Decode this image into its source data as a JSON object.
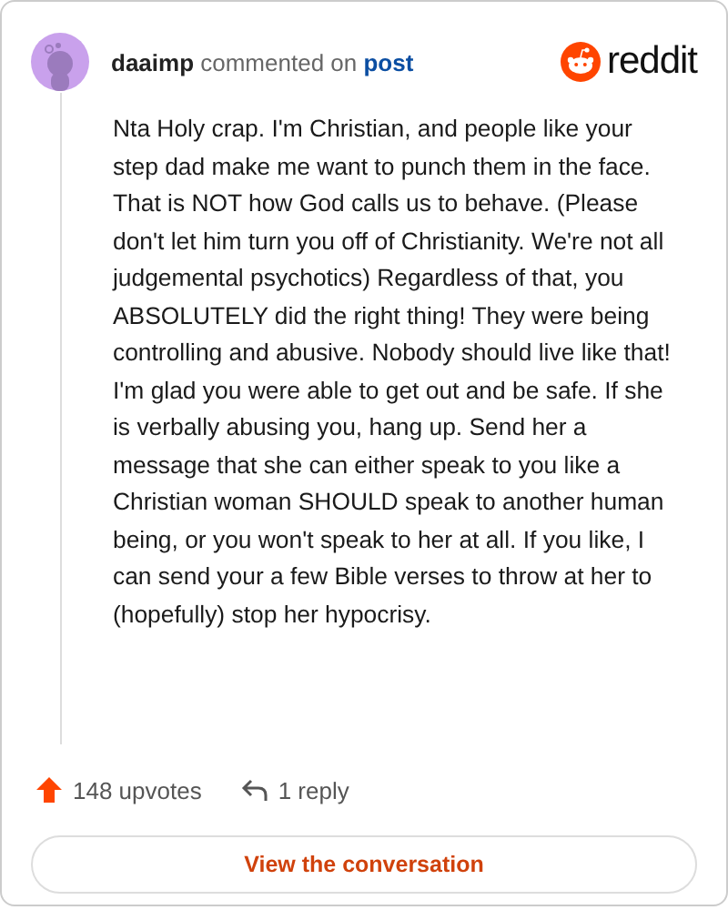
{
  "comment": {
    "author": "daaimp",
    "action": "commented on",
    "target": "post",
    "brand": "reddit",
    "body": "Nta Holy crap. I'm Christian, and people like your step dad make me want to punch them in the face. That is NOT how God calls us to behave. (Please don't let him turn you off of Christianity. We're not all judgemental psychotics) Regardless of that, you ABSOLUTELY did the right thing! They were being controlling and abusive. Nobody should live like that! I'm glad you were able to get out and be safe. If she is verbally abusing you, hang up. Send her a message that she can either speak to you like a Christian woman SHOULD speak to another human being, or you won't speak to her at all. If you like, I can send your a few Bible verses to throw at her to (hopefully) stop her hypocrisy.",
    "upvotes": "148 upvotes",
    "replies": "1 reply",
    "button": "View the conversation"
  }
}
